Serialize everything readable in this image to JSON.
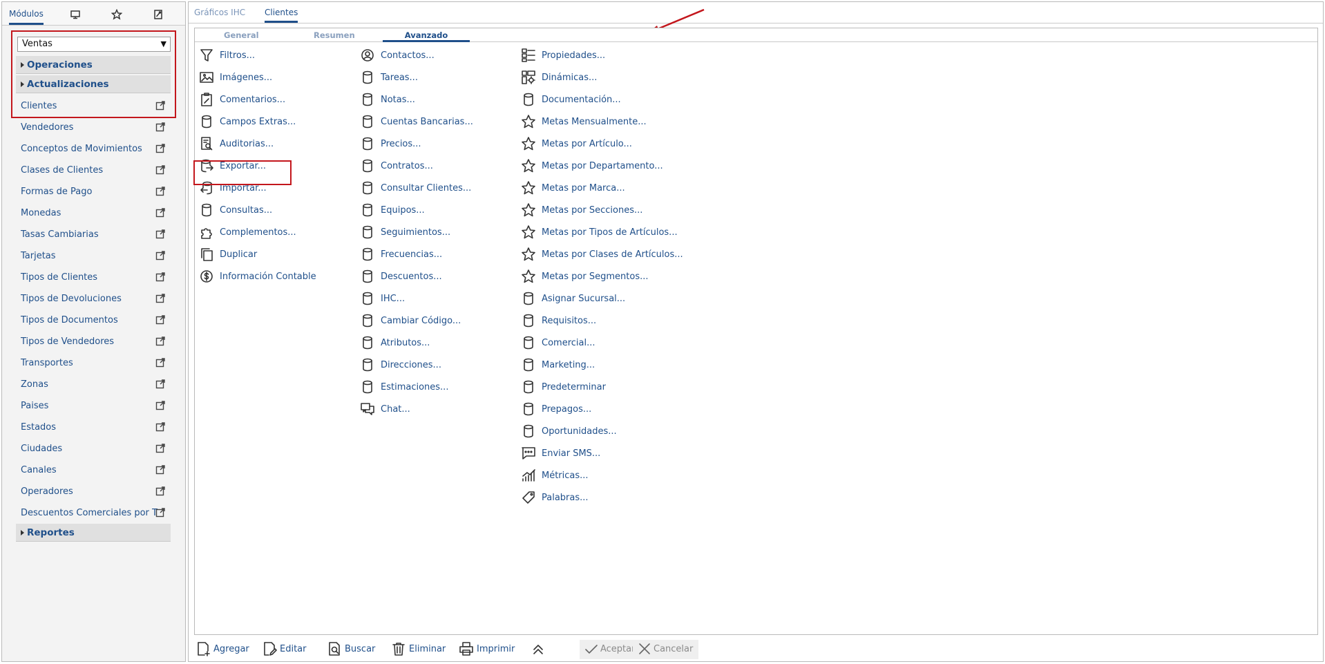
{
  "sidebar": {
    "tabs": [
      {
        "label": "Módulos",
        "icon": null
      },
      {
        "label": null,
        "icon": "monitor-icon"
      },
      {
        "label": null,
        "icon": "star-icon"
      },
      {
        "label": null,
        "icon": "report-icon"
      }
    ],
    "module_select": {
      "value": "Ventas"
    },
    "groups": {
      "operaciones": "Operaciones",
      "actualizaciones": "Actualizaciones",
      "reportes": "Reportes"
    },
    "items": [
      "Clientes",
      "Vendedores",
      "Conceptos de Movimientos",
      "Clases de Clientes",
      "Formas de Pago",
      "Monedas",
      "Tasas Cambiarias",
      "Tarjetas",
      "Tipos de Clientes",
      "Tipos de Devoluciones",
      "Tipos de Documentos",
      "Tipos de Vendedores",
      "Transportes",
      "Zonas",
      "Paises",
      "Estados",
      "Ciudades",
      "Canales",
      "Operadores",
      "Descuentos Comerciales por T"
    ]
  },
  "main": {
    "top_tabs": [
      "Gráficos IHC",
      "Clientes"
    ],
    "sub_tabs": [
      "General",
      "Resumen",
      "Avanzado"
    ],
    "columns": [
      [
        {
          "label": "Filtros...",
          "icon": "filter-icon"
        },
        {
          "label": "Imágenes...",
          "icon": "image-icon"
        },
        {
          "label": "Comentarios...",
          "icon": "clipboard-edit-icon"
        },
        {
          "label": "Campos Extras...",
          "icon": "database-icon"
        },
        {
          "label": "Auditorias...",
          "icon": "audit-search-icon"
        },
        {
          "label": "Exportar...",
          "icon": "database-export-icon"
        },
        {
          "label": "Importar...",
          "icon": "database-import-icon"
        },
        {
          "label": "Consultas...",
          "icon": "database-icon"
        },
        {
          "label": "Complementos...",
          "icon": "puzzle-icon"
        },
        {
          "label": "Duplicar",
          "icon": "copy-icon"
        },
        {
          "label": "Información Contable",
          "icon": "dollar-circle-icon"
        }
      ],
      [
        {
          "label": "Contactos...",
          "icon": "user-circle-icon"
        },
        {
          "label": "Tareas...",
          "icon": "database-icon"
        },
        {
          "label": "Notas...",
          "icon": "database-icon"
        },
        {
          "label": "Cuentas Bancarias...",
          "icon": "database-icon"
        },
        {
          "label": "Precios...",
          "icon": "database-icon"
        },
        {
          "label": "Contratos...",
          "icon": "database-icon"
        },
        {
          "label": "Consultar Clientes...",
          "icon": "database-icon"
        },
        {
          "label": "Equipos...",
          "icon": "database-icon"
        },
        {
          "label": "Seguimientos...",
          "icon": "database-icon"
        },
        {
          "label": "Frecuencias...",
          "icon": "database-icon"
        },
        {
          "label": "Descuentos...",
          "icon": "database-icon"
        },
        {
          "label": "IHC...",
          "icon": "database-icon"
        },
        {
          "label": "Cambiar Código...",
          "icon": "database-icon"
        },
        {
          "label": "Atributos...",
          "icon": "database-icon"
        },
        {
          "label": "Direcciones...",
          "icon": "database-icon"
        },
        {
          "label": "Estimaciones...",
          "icon": "database-icon"
        },
        {
          "label": "Chat...",
          "icon": "chat-icon"
        }
      ],
      [
        {
          "label": "Propiedades...",
          "icon": "list-grid-icon"
        },
        {
          "label": "Dinámicas...",
          "icon": "dynamic-grid-icon"
        },
        {
          "label": "Documentación...",
          "icon": "database-icon"
        },
        {
          "label": "Metas Mensualmente...",
          "icon": "star-icon"
        },
        {
          "label": "Metas por Artículo...",
          "icon": "star-icon"
        },
        {
          "label": "Metas por Departamento...",
          "icon": "star-icon"
        },
        {
          "label": "Metas por Marca...",
          "icon": "star-icon"
        },
        {
          "label": "Metas por Secciones...",
          "icon": "star-icon"
        },
        {
          "label": "Metas por Tipos de Artículos...",
          "icon": "star-icon"
        },
        {
          "label": "Metas por Clases de Artículos...",
          "icon": "star-icon"
        },
        {
          "label": "Metas por Segmentos...",
          "icon": "star-icon"
        },
        {
          "label": "Asignar Sucursal...",
          "icon": "database-icon"
        },
        {
          "label": "Requisitos...",
          "icon": "database-icon"
        },
        {
          "label": "Comercial...",
          "icon": "database-icon"
        },
        {
          "label": "Marketing...",
          "icon": "database-icon"
        },
        {
          "label": "Predeterminar",
          "icon": "database-icon"
        },
        {
          "label": "Prepagos...",
          "icon": "database-icon"
        },
        {
          "label": "Oportunidades...",
          "icon": "database-icon"
        },
        {
          "label": "Enviar SMS...",
          "icon": "sms-icon"
        },
        {
          "label": "Métricas...",
          "icon": "metrics-icon"
        },
        {
          "label": "Palabras...",
          "icon": "tag-icon"
        }
      ]
    ],
    "bottom_buttons": [
      {
        "label": "Agregar",
        "icon": "add-document-icon"
      },
      {
        "label": "Editar",
        "icon": "edit-document-icon"
      },
      {
        "label": "Buscar",
        "icon": "search-document-icon"
      },
      {
        "label": "Eliminar",
        "icon": "trash-icon"
      },
      {
        "label": "Imprimir",
        "icon": "printer-icon"
      },
      {
        "label": "",
        "icon": "chevron-double-up-icon"
      },
      {
        "label": "Aceptar",
        "icon": "check-icon"
      },
      {
        "label": "Cancelar",
        "icon": "x-icon"
      }
    ]
  },
  "colors": {
    "link": "#1f4f8a",
    "annotation": "#c3161c",
    "tab_inactive": "#8aa0be"
  }
}
